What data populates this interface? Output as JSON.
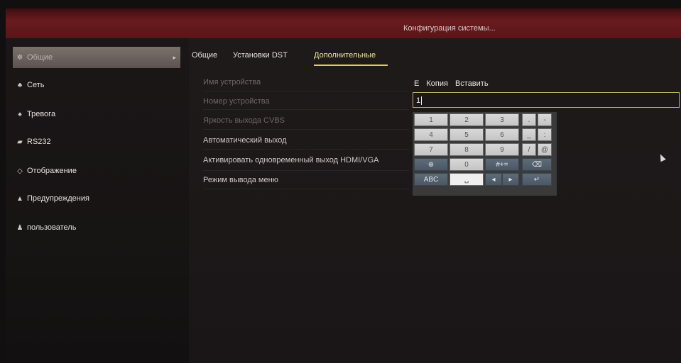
{
  "title": "Конфигурация системы...",
  "sidebar": {
    "items": [
      {
        "label": "Общие",
        "icon": "gear-icon",
        "active": true
      },
      {
        "label": "Сеть",
        "icon": "network-icon",
        "active": false
      },
      {
        "label": "Тревога",
        "icon": "alarm-icon",
        "active": false
      },
      {
        "label": "RS232",
        "icon": "serial-port-icon",
        "active": false
      },
      {
        "label": "Отображение",
        "icon": "display-icon",
        "active": false
      },
      {
        "label": "Предупреждения",
        "icon": "warning-icon",
        "active": false
      },
      {
        "label": "пользователь",
        "icon": "users-icon",
        "active": false
      }
    ]
  },
  "tabs": {
    "general": "Общие",
    "dst": "Установки DST",
    "advanced": "Дополнительные"
  },
  "settings": {
    "device_name": "Имя устройства",
    "device_number": "Номер устройства",
    "cvbs_brightness": "Яркость выхода CVBS",
    "auto_logout": "Автоматический выход",
    "hdmi_vga": "Активировать одновременный выход HDMI/VGA",
    "menu_output": "Режим вывода меню"
  },
  "keyboard": {
    "toolbar_mark": "E",
    "copy": "Копия",
    "paste": "Вставить",
    "input_value": "1",
    "keys": {
      "k1": "1",
      "k2": "2",
      "k3": "3",
      "k4": "4",
      "k5": "5",
      "k6": "6",
      "k7": "7",
      "k8": "8",
      "k9": "9",
      "k0": "0",
      "dot": ".",
      "dash": "-",
      "underscore": "_",
      "colon": ":",
      "slash": "/",
      "at": "@",
      "symbols": "#+=",
      "abc": "ABC"
    }
  },
  "colors": {
    "titlebar": "#6a1b1e",
    "active_tab": "#e8e4a0",
    "input_border": "#b8b26a"
  }
}
